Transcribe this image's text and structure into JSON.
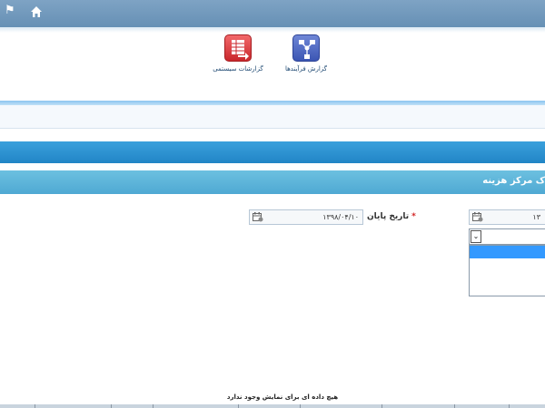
{
  "topbar": {
    "flag_glyph": "⚑",
    "home_icon": "home-icon"
  },
  "toolbar": {
    "items": [
      {
        "label": "گزارش فرآیندها",
        "icon": "process-network-icon",
        "color": "#3c56b3"
      },
      {
        "label": "گزارشات سیستمی",
        "icon": "system-report-icon",
        "color": "#c9272c"
      }
    ]
  },
  "panel": {
    "title": "ک مرکز هزینه"
  },
  "form": {
    "end_date": {
      "label": "تاریخ پایان",
      "required_mark": "*",
      "value": "۱۳۹۸/۰۴/۱۰"
    },
    "start_date": {
      "value": "۱۳"
    },
    "combo": {
      "arrow_glyph": "⌄"
    }
  },
  "grid": {
    "empty_message": "هیچ داده ای برای نمایش وجود ندارد"
  },
  "colors": {
    "topbar": "#6f98bc",
    "bluebar": "#2a8fcf",
    "titlebar": "#5cb4da",
    "selection": "#3399ff"
  }
}
